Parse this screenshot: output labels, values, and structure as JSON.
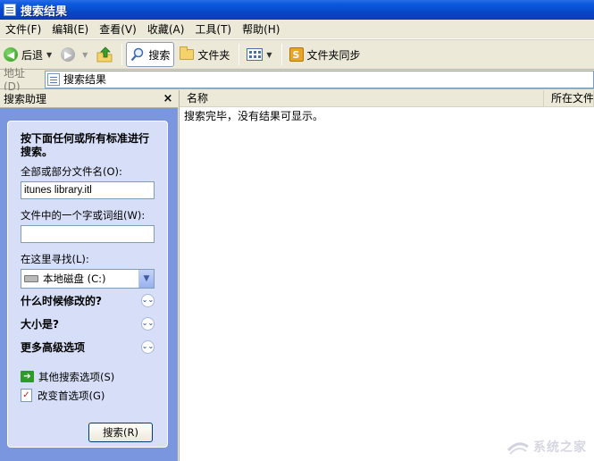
{
  "window": {
    "title": "搜索结果"
  },
  "menu": [
    "文件(F)",
    "编辑(E)",
    "查看(V)",
    "收藏(A)",
    "工具(T)",
    "帮助(H)"
  ],
  "toolbar": {
    "back": "后退",
    "search": "搜索",
    "folders": "文件夹",
    "folder_sync": "文件夹同步",
    "sync_icon_letter": "S"
  },
  "address": {
    "label": "地址(D)",
    "value": "搜索结果"
  },
  "search_pane": {
    "title": "搜索助理",
    "close": "×",
    "prompt": "按下面任何或所有标准进行搜索。",
    "filename_label": "全部或部分文件名(O):",
    "filename_value": "itunes library.itl",
    "phrase_label": "文件中的一个字或词组(W):",
    "phrase_value": "",
    "lookin_label": "在这里寻找(L):",
    "lookin_value": "本地磁盘 (C:)",
    "when_modified": "什么时候修改的?",
    "size": "大小是?",
    "advanced": "更多高级选项",
    "other_options": "其他搜索选项(S)",
    "change_prefs": "改变首选项(G)",
    "search_button": "搜索(R)"
  },
  "results": {
    "columns": [
      "名称",
      "所在文件夹"
    ],
    "message": "搜索完毕，没有结果可显示。"
  },
  "watermark": "系统之家"
}
